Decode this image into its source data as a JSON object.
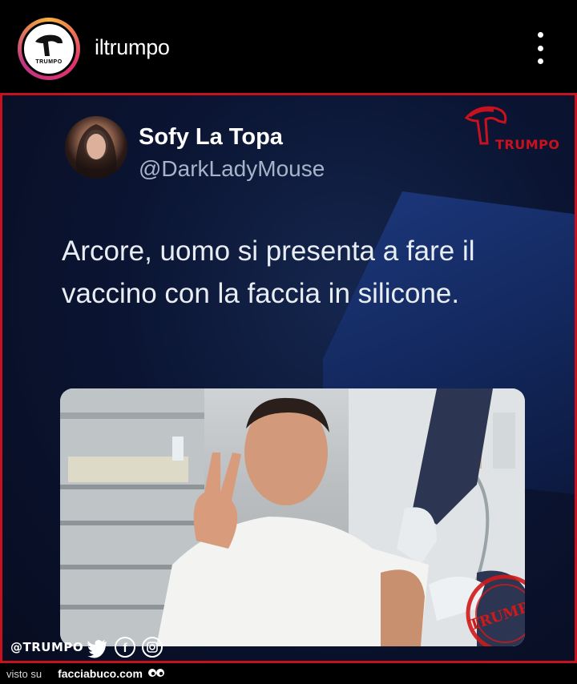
{
  "header": {
    "username": "iltrumpo",
    "avatar_text": "TRUMPO"
  },
  "post": {
    "brand_text": "TRUMPO",
    "tweet": {
      "name": "Sofy La Topa",
      "handle": "@DarkLadyMouse",
      "text": "Arcore, uomo si presenta a fare il vaccino con la faccia in silicone."
    },
    "footer_handle": "@TRUMPO",
    "stamp_text": "TRUMPO"
  },
  "watermark": {
    "prefix": "visto su",
    "site": "facciabuco.com"
  },
  "colors": {
    "brand_red": "#c8111e",
    "post_bg": "#0b1533",
    "handle_gray": "#a8b3c8"
  }
}
